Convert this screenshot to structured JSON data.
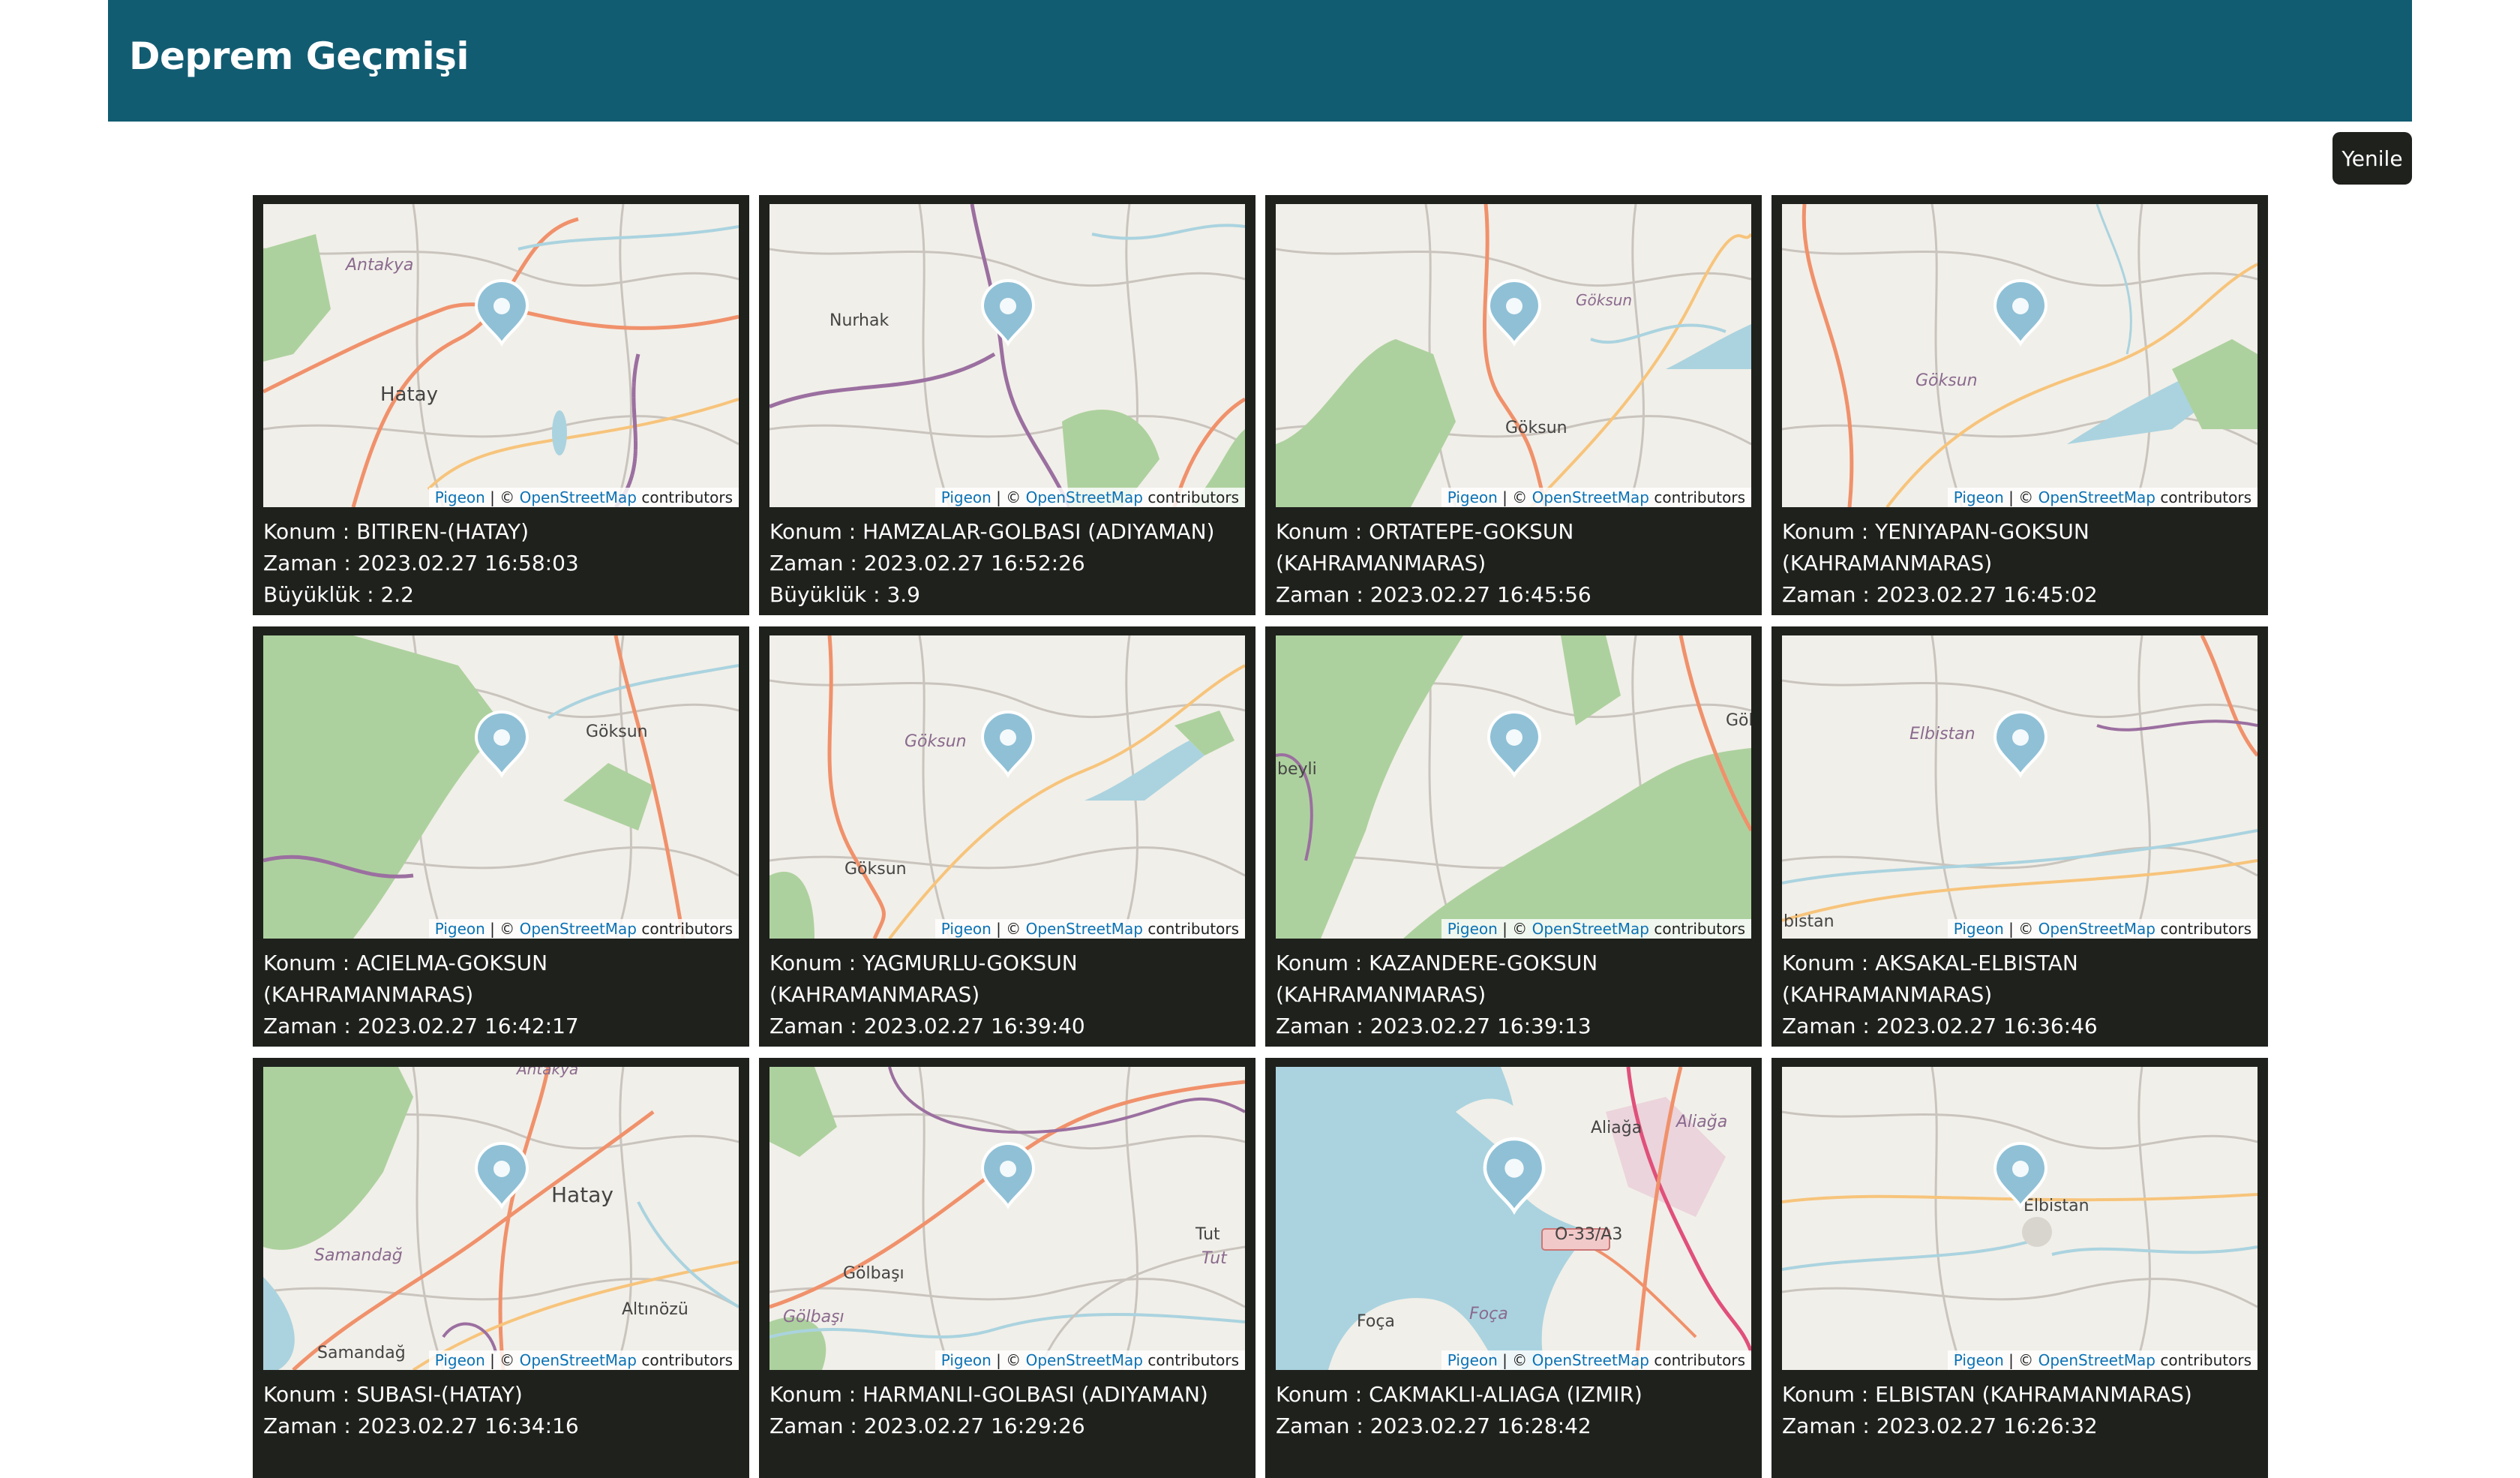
{
  "header": {
    "title": "Deprem Geçmişi"
  },
  "toolbar": {
    "refresh_label": "Yenile"
  },
  "labels": {
    "konum": "Konum : ",
    "zaman": "Zaman : ",
    "buyukluk": "Büyüklük : "
  },
  "attribution": {
    "pigeon": "Pigeon",
    "sep": " | © ",
    "osm": "OpenStreetMap",
    "contributors": " contributors"
  },
  "map_colors": {
    "land": "#f1efe9",
    "forest": "#add19e",
    "water": "#aad3df",
    "major_road": "#f0916b",
    "secondary_road": "#f7c47b",
    "border": "#9b6fa0",
    "marker": "#8fc0d6"
  },
  "cards": [
    {
      "konum": "BITIREN-(HATAY)",
      "zaman": "2023.02.27 16:58:03",
      "buyukluk": "2.2",
      "place_labels": [
        "Antakya",
        "Hatay"
      ]
    },
    {
      "konum": "HAMZALAR-GOLBASI (ADIYAMAN)",
      "zaman": "2023.02.27 16:52:26",
      "buyukluk": "3.9",
      "place_labels": [
        "Nurhak"
      ]
    },
    {
      "konum": "ORTATEPE-GOKSUN (KAHRAMANMARAS)",
      "zaman": "2023.02.27 16:45:56",
      "place_labels": [
        "Göksun",
        "Göksun"
      ]
    },
    {
      "konum": "YENIYAPAN-GOKSUN (KAHRAMANMARAS)",
      "zaman": "2023.02.27 16:45:02",
      "place_labels": [
        "Göksun"
      ]
    },
    {
      "konum": "ACIELMA-GOKSUN (KAHRAMANMARAS)",
      "zaman": "2023.02.27 16:42:17",
      "place_labels": [
        "Göksun"
      ]
    },
    {
      "konum": "YAGMURLU-GOKSUN (KAHRAMANMARAS)",
      "zaman": "2023.02.27 16:39:40",
      "place_labels": [
        "Göksun",
        "Göksun"
      ]
    },
    {
      "konum": "KAZANDERE-GOKSUN (KAHRAMANMARAS)",
      "zaman": "2023.02.27 16:39:13",
      "place_labels": [
        "Göksun",
        "beyli"
      ]
    },
    {
      "konum": "AKSAKAL-ELBISTAN (KAHRAMANMARAS)",
      "zaman": "2023.02.27 16:36:46",
      "place_labels": [
        "Elbistan",
        "bistan"
      ]
    },
    {
      "konum": "SUBASI-(HATAY)",
      "zaman": "2023.02.27 16:34:16",
      "place_labels": [
        "Antakya",
        "Hatay",
        "Samandağ",
        "Samandağ",
        "Altınözü"
      ]
    },
    {
      "konum": "HARMANLI-GOLBASI (ADIYAMAN)",
      "zaman": "2023.02.27 16:29:26",
      "place_labels": [
        "Gölbaşı",
        "Tut",
        "Tut",
        "Gölbaşı"
      ]
    },
    {
      "konum": "CAKMAKLI-ALIAGA (IZMIR)",
      "zaman": "2023.02.27 16:28:42",
      "place_labels": [
        "Aliağa",
        "Aliağa",
        "O-33/A3",
        "Foça",
        "Foça"
      ]
    },
    {
      "konum": "ELBISTAN (KAHRAMANMARAS)",
      "zaman": "2023.02.27 16:26:32",
      "place_labels": [
        "Elbistan"
      ]
    }
  ]
}
